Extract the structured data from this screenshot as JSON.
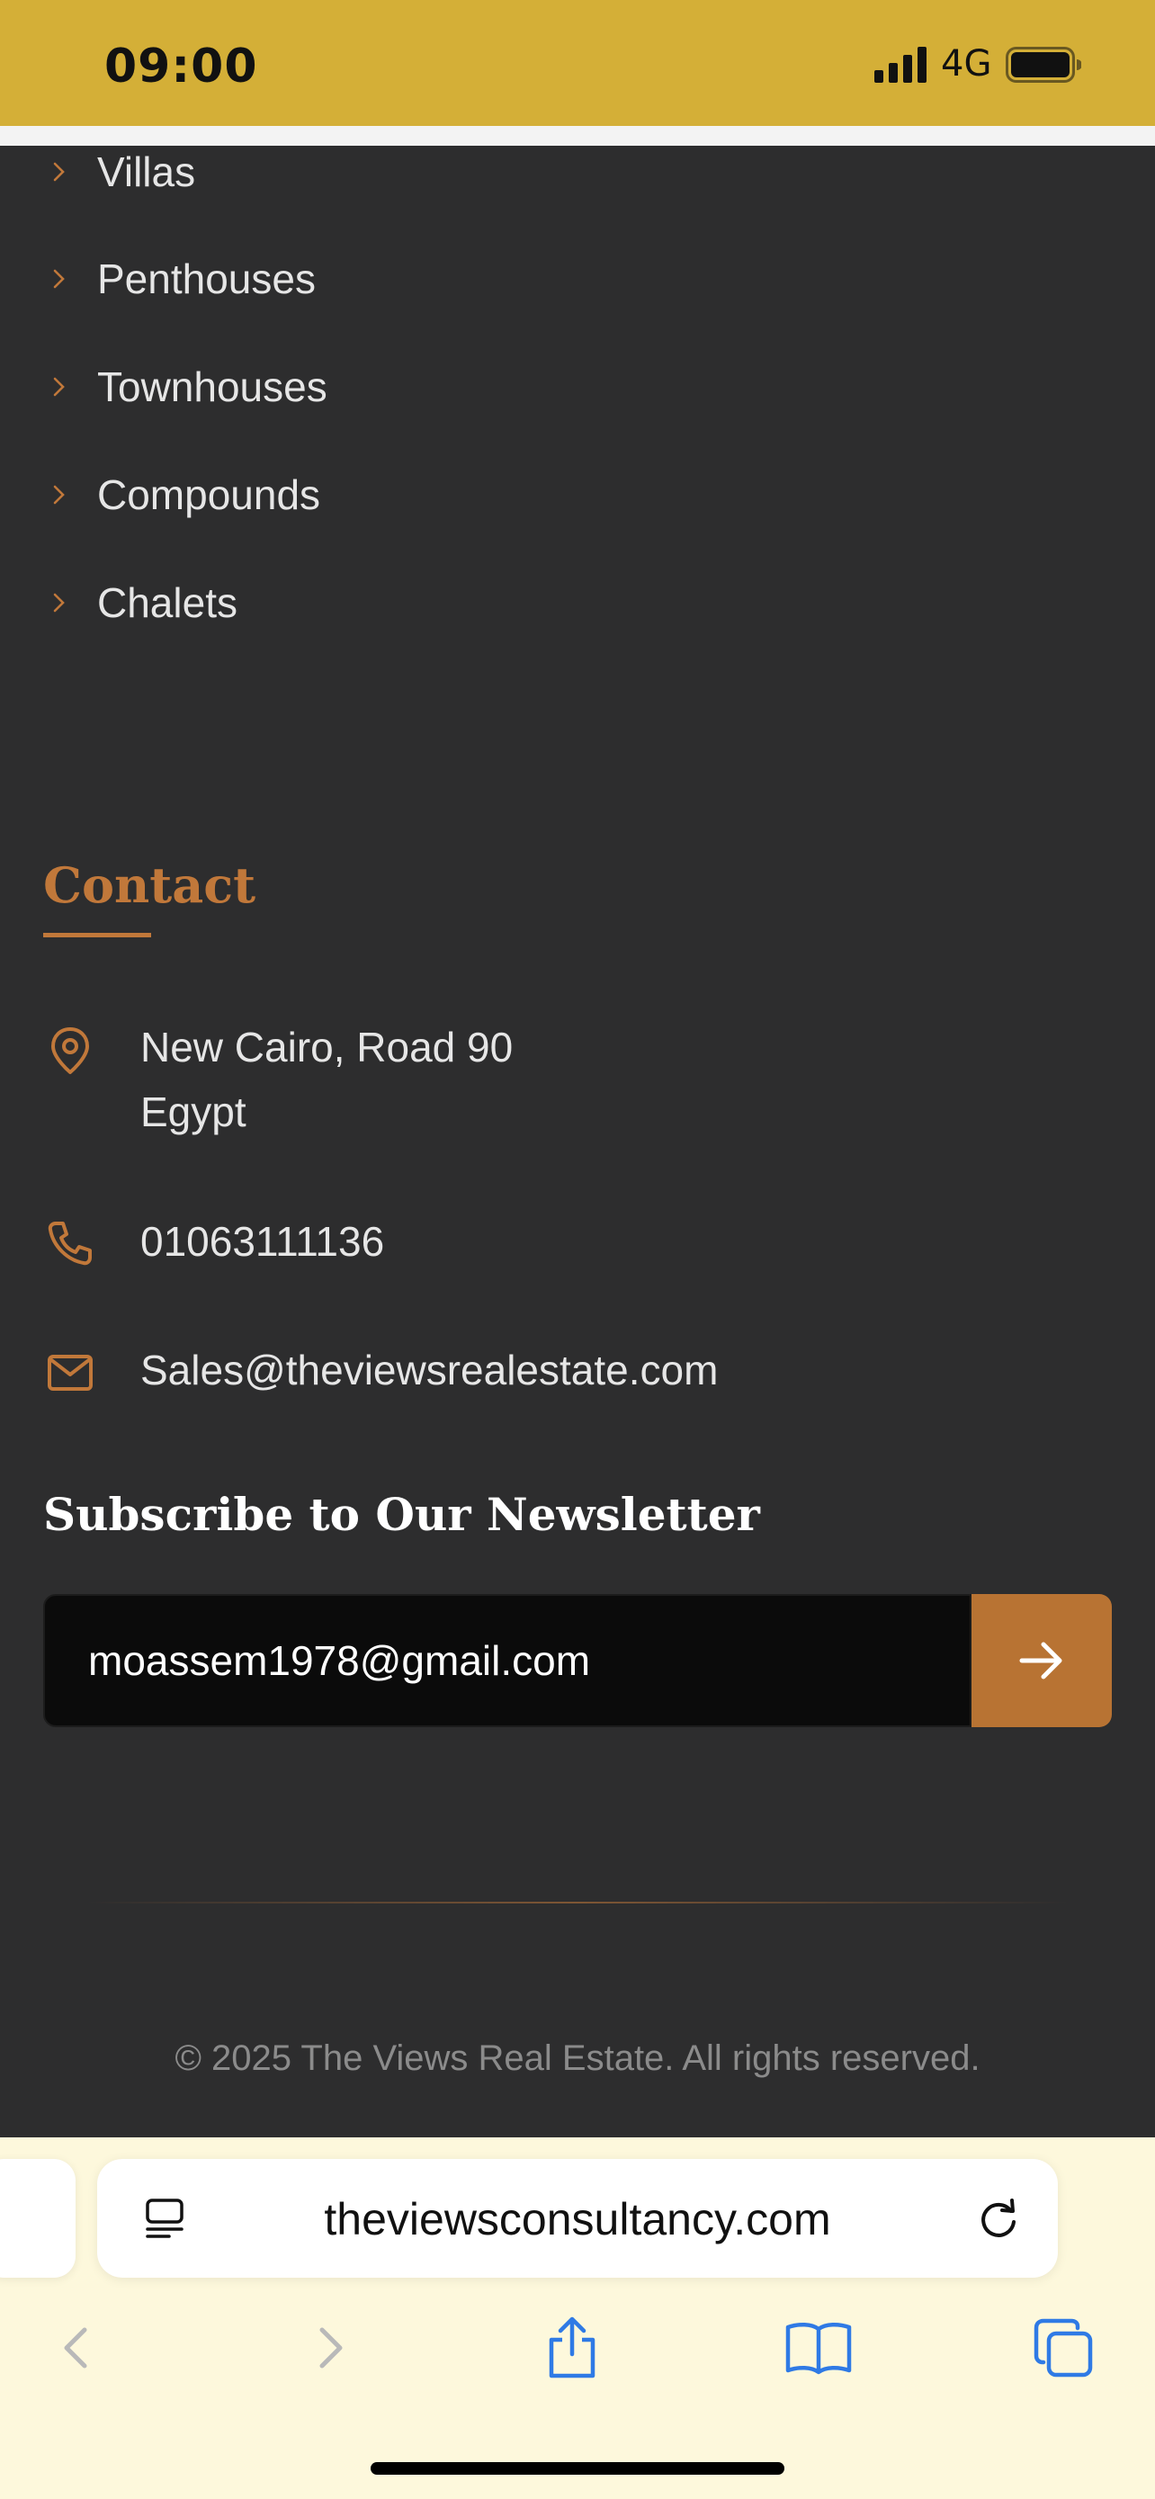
{
  "status_bar": {
    "time": "09:00",
    "network": "4G"
  },
  "menu": {
    "items": [
      {
        "label": "Villas"
      },
      {
        "label": "Penthouses"
      },
      {
        "label": "Townhouses"
      },
      {
        "label": "Compounds"
      },
      {
        "label": "Chalets"
      }
    ]
  },
  "contact": {
    "title": "Contact",
    "address_line1": "New Cairo, Road 90",
    "address_line2": "Egypt",
    "phone": "01063111136",
    "email": "Sales@theviewsrealestate.com",
    "icons": [
      "location-pin-icon",
      "phone-icon",
      "envelope-icon"
    ]
  },
  "newsletter": {
    "title": "Subscribe to Our Newsletter",
    "email_value": "moassem1978@gmail.com",
    "submit_icon": "arrow-right-icon"
  },
  "footer": {
    "copyright": "© 2025 The Views Real Estate. All rights reserved."
  },
  "browser": {
    "url": "theviewsconsultancy.com",
    "toolbar": [
      "back-icon",
      "forward-icon",
      "share-icon",
      "bookmarks-icon",
      "tabs-icon"
    ]
  },
  "colors": {
    "status_bar": "#d4af37",
    "page_bg": "#2d2d2e",
    "accent": "#c1783a",
    "button": "#b87333",
    "browser_chrome": "#fdf8dc",
    "ios_blue": "#2f7ae5"
  }
}
